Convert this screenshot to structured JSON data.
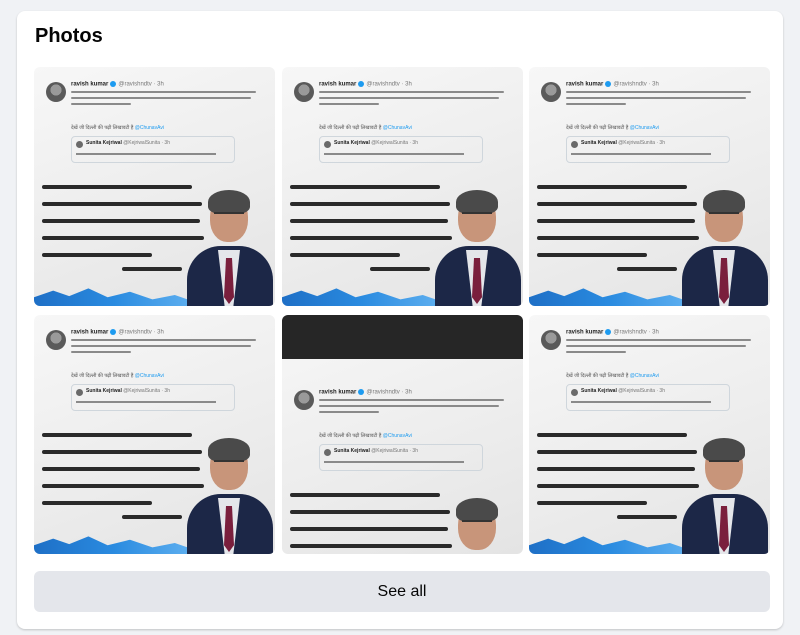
{
  "section": {
    "title": "Photos",
    "see_all_label": "See all"
  },
  "photo_template": {
    "tweet_name": "ravish kumar",
    "tweet_handle": "@ravishndtv · 3h",
    "tweet_link_prefix": "देखें जी दिल्ली की पढ़ी लिखावटी है",
    "tweet_link_tag": "@ChunavAvi",
    "quote_name": "Sunita Kejriwal",
    "quote_handle": "@KejriwalSunita · 3h"
  },
  "photos": [
    {
      "name": "photo-1",
      "layout": "normal"
    },
    {
      "name": "photo-2",
      "layout": "normal"
    },
    {
      "name": "photo-3",
      "layout": "normal"
    },
    {
      "name": "photo-4",
      "layout": "normal"
    },
    {
      "name": "photo-5",
      "layout": "shifted"
    },
    {
      "name": "photo-6",
      "layout": "normal"
    }
  ],
  "colors": {
    "background": "#f0f2f5",
    "card": "#ffffff",
    "button": "#e4e6eb",
    "accent_blue": "#1d9bf0",
    "suit": "#1c2747",
    "tie": "#7a1f3d"
  }
}
